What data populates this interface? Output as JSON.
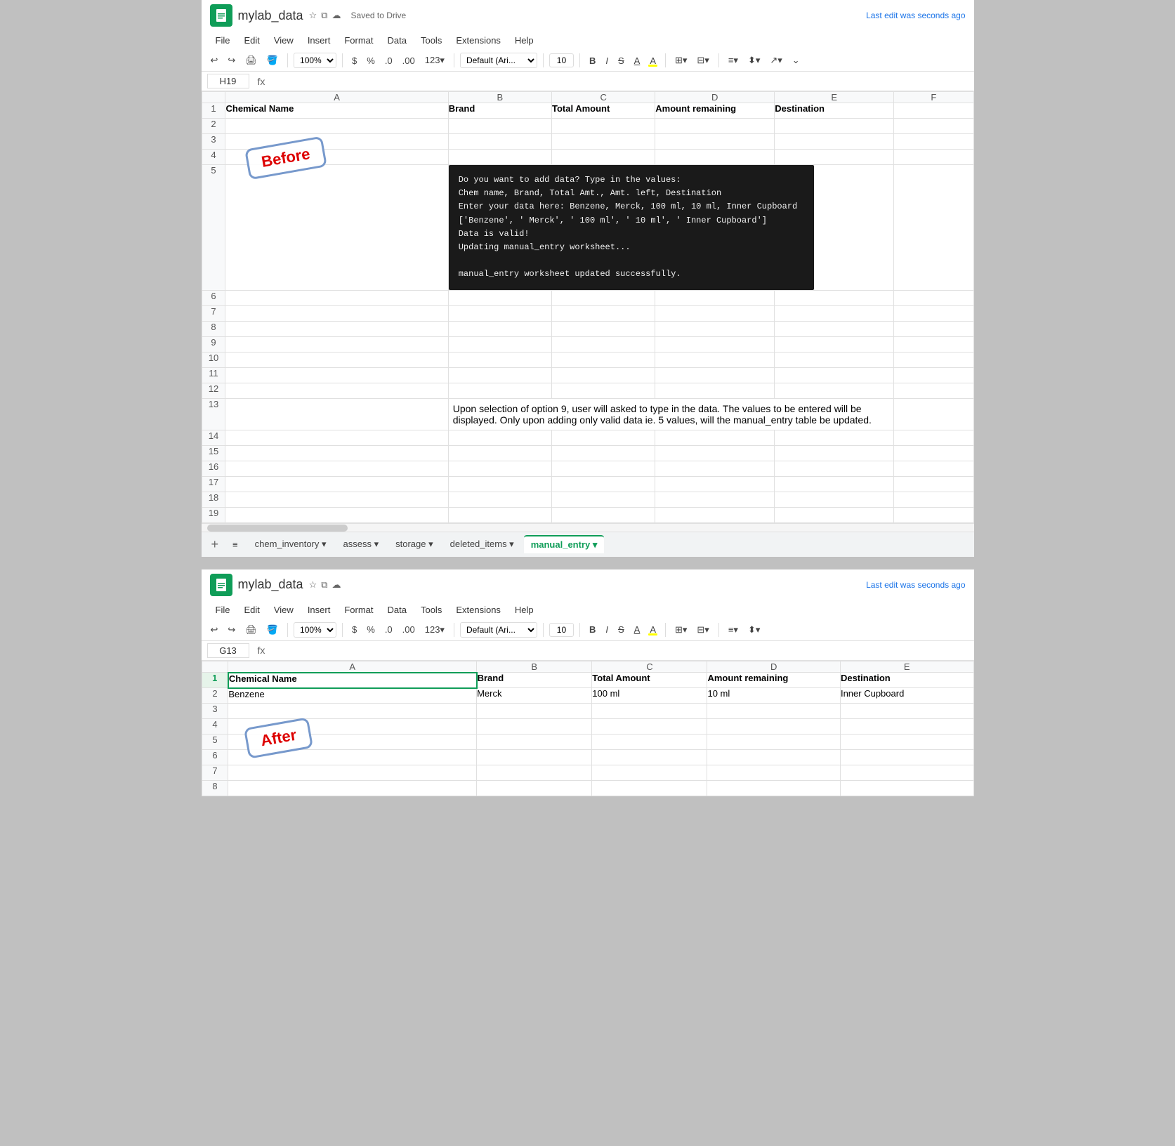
{
  "top_sheet": {
    "title": "mylab_data",
    "saved_text": "Saved to Drive",
    "last_edit": "Last edit was seconds ago",
    "cell_ref": "H19",
    "formula": "",
    "zoom": "100%",
    "font_name": "Default (Ari...",
    "font_size": "10",
    "menu_items": [
      "File",
      "Edit",
      "View",
      "Insert",
      "Format",
      "Data",
      "Tools",
      "Extensions",
      "Help"
    ],
    "columns": [
      "A",
      "B",
      "C",
      "D",
      "E",
      "F"
    ],
    "headers": [
      "Chemical Name",
      "Brand",
      "Total Amount",
      "Amount remaining",
      "Destination"
    ],
    "terminal": {
      "lines": [
        "Do you want to add data? Type in the values:",
        "Chem name, Brand, Total Amt., Amt. left, Destination",
        "Enter your data here: Benzene, Merck, 100 ml, 10 ml, Inner Cupboard",
        "['Benzene', ' Merck', ' 100 ml', ' 10 ml', ' Inner Cupboard']",
        "Data is valid!",
        "Updating manual_entry worksheet...",
        "",
        "manual_entry worksheet updated successfully."
      ]
    },
    "description": "Upon selection of option 9, user will asked to type in the data. The values to be entered will be displayed. Only upon adding only valid data ie.  5 values, will the manual_entry table be updated.",
    "stamp_before": "Before",
    "tabs": [
      "chem_inventory",
      "assess",
      "storage",
      "deleted_items",
      "manual_entry"
    ],
    "active_tab": "manual_entry"
  },
  "bottom_sheet": {
    "title": "mylab_data",
    "last_edit": "Last edit was seconds ago",
    "cell_ref": "G13",
    "formula": "",
    "zoom": "100%",
    "font_name": "Default (Ari...",
    "font_size": "10",
    "menu_items": [
      "File",
      "Edit",
      "View",
      "Insert",
      "Format",
      "Data",
      "Tools",
      "Extensions",
      "Help"
    ],
    "columns": [
      "A",
      "B",
      "C",
      "D",
      "E"
    ],
    "headers": [
      "Chemical Name",
      "Brand",
      "Total Amount",
      "Amount remaining",
      "Destination"
    ],
    "data_rows": [
      [
        "Benzene",
        "Merck",
        "100 ml",
        "10 ml",
        "Inner Cupboard"
      ]
    ],
    "stamp_after": "After"
  },
  "icons": {
    "undo": "↩",
    "redo": "↪",
    "print": "🖨",
    "paint_format": "🪣",
    "bold": "B",
    "italic": "I",
    "strikethrough": "S",
    "underline": "A",
    "fill": "A",
    "border": "⊞",
    "merge": "⊟",
    "align_h": "≡",
    "align_v": "⬍",
    "text_rotation": "↗",
    "more": "⌄",
    "star": "☆",
    "presentation": "⧉",
    "cloud": "☁",
    "dropdown": "▾",
    "plus": "+",
    "hamburger": "≡",
    "percent": "%",
    "dollar": "$",
    "decrease_decimal": ".0",
    "increase_decimal": ".00",
    "format123": "123"
  }
}
